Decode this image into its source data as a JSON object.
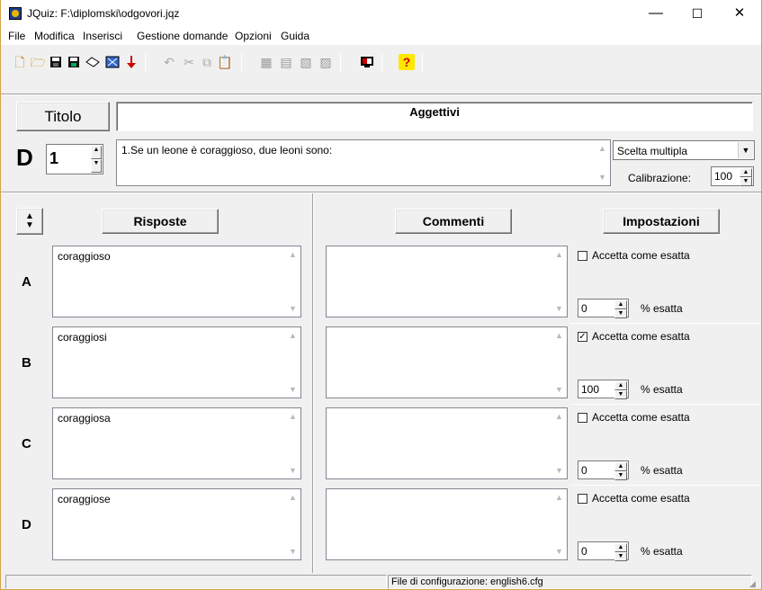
{
  "window": {
    "title": "JQuiz: F:\\diplomski\\odgovori.jqz",
    "minimize": "—",
    "maximize": "☐",
    "close": "✕"
  },
  "menu": [
    "File",
    "Modifica",
    "Inserisci",
    "Gestione domande",
    "Opzioni",
    "Guida"
  ],
  "toolbar_icons": [
    "new-file-icon",
    "open-folder-icon",
    "save-icon",
    "save-as-icon",
    "eraser-icon",
    "web-export-icon",
    "down-arrow-icon",
    "undo-icon",
    "cut-icon",
    "copy-icon",
    "paste-icon",
    "tool-1-icon",
    "tool-2-icon",
    "tool-3-icon",
    "tool-4-icon",
    "screen-icon",
    "help-icon"
  ],
  "header": {
    "title_button": "Titolo",
    "title_value": "Aggettivi",
    "question_letter": "D",
    "question_number": "1",
    "question_text": "1.Se un leone è coraggioso, due leoni sono:",
    "question_type": "Scelta multipla",
    "calibration_label": "Calibrazione:",
    "calibration_value": "100"
  },
  "columns": {
    "answers_button": "Risposte",
    "comments_button": "Commenti",
    "settings_button": "Impostazioni"
  },
  "answers": [
    {
      "letter": "A",
      "text": "coraggioso",
      "comment": "",
      "accept_label": "Accetta come esatta",
      "accepted": false,
      "percent": "0",
      "percent_label": "% esatta"
    },
    {
      "letter": "B",
      "text": "coraggiosi",
      "comment": "",
      "accept_label": "Accetta come esatta",
      "accepted": true,
      "percent": "100",
      "percent_label": "% esatta"
    },
    {
      "letter": "C",
      "text": "coraggiosa",
      "comment": "",
      "accept_label": "Accetta come esatta",
      "accepted": false,
      "percent": "0",
      "percent_label": "% esatta"
    },
    {
      "letter": "D",
      "text": "coraggiose",
      "comment": "",
      "accept_label": "Accetta come esatta",
      "accepted": false,
      "percent": "0",
      "percent_label": "% esatta"
    }
  ],
  "status": {
    "config": "File di configurazione: english6.cfg"
  },
  "glyphs": {
    "up": "▲",
    "down": "▼",
    "check": "✓"
  }
}
